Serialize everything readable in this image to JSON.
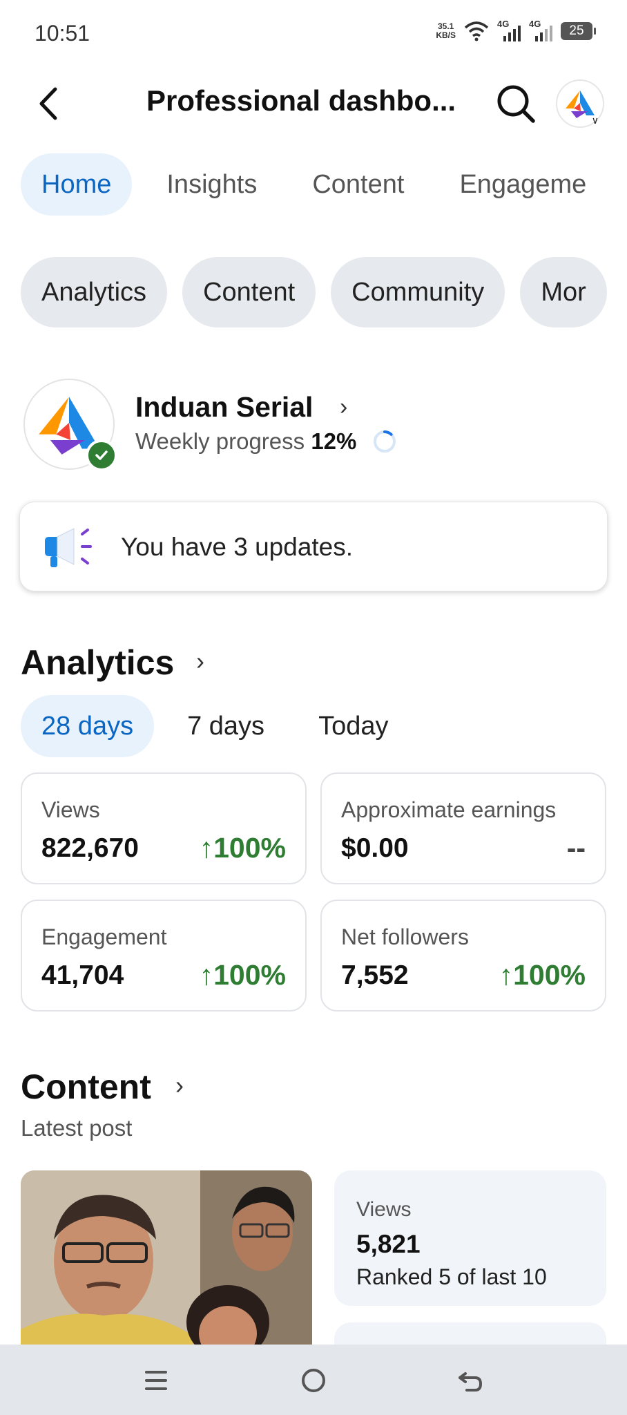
{
  "status_bar": {
    "time": "10:51",
    "net_speed_value": "35.1",
    "net_speed_unit": "KB/S",
    "signal_1_label": "4G",
    "signal_2_label": "4G",
    "battery": "25"
  },
  "header": {
    "title": "Professional dashbo...",
    "back_icon": "back-arrow-icon",
    "search_icon": "search-icon"
  },
  "top_tabs": [
    {
      "label": "Home",
      "active": true
    },
    {
      "label": "Insights",
      "active": false
    },
    {
      "label": "Content",
      "active": false
    },
    {
      "label": "Engageme",
      "active": false
    }
  ],
  "chips": [
    {
      "label": "Analytics"
    },
    {
      "label": "Content"
    },
    {
      "label": "Community"
    },
    {
      "label": "Mor"
    }
  ],
  "profile": {
    "name": "Induan Serial",
    "weekly_label": "Weekly progress",
    "weekly_value": "12%",
    "weekly_progress_fraction": 0.12
  },
  "updates": {
    "text": "You have 3 updates."
  },
  "analytics": {
    "title": "Analytics",
    "ranges": [
      {
        "label": "28 days",
        "active": true
      },
      {
        "label": "7 days",
        "active": false
      },
      {
        "label": "Today",
        "active": false
      }
    ],
    "stats": [
      {
        "label": "Views",
        "value": "822,670",
        "change": "100%",
        "trend": "up"
      },
      {
        "label": "Approximate earnings",
        "value": "$0.00",
        "change": "--",
        "trend": "none"
      },
      {
        "label": "Engagement",
        "value": "41,704",
        "change": "100%",
        "trend": "up"
      },
      {
        "label": "Net followers",
        "value": "7,552",
        "change": "100%",
        "trend": "up"
      }
    ]
  },
  "content": {
    "title": "Content",
    "subtitle": "Latest post",
    "post_views_label": "Views",
    "post_views_value": "5,821",
    "post_rank": "Ranked 5 of last 10"
  },
  "colors": {
    "accent": "#0a66c2",
    "active_tab_bg": "#e8f2fc",
    "positive": "#2e7d32",
    "chip_bg": "#e6e9ed",
    "nav_bg": "#e3e6ea"
  }
}
